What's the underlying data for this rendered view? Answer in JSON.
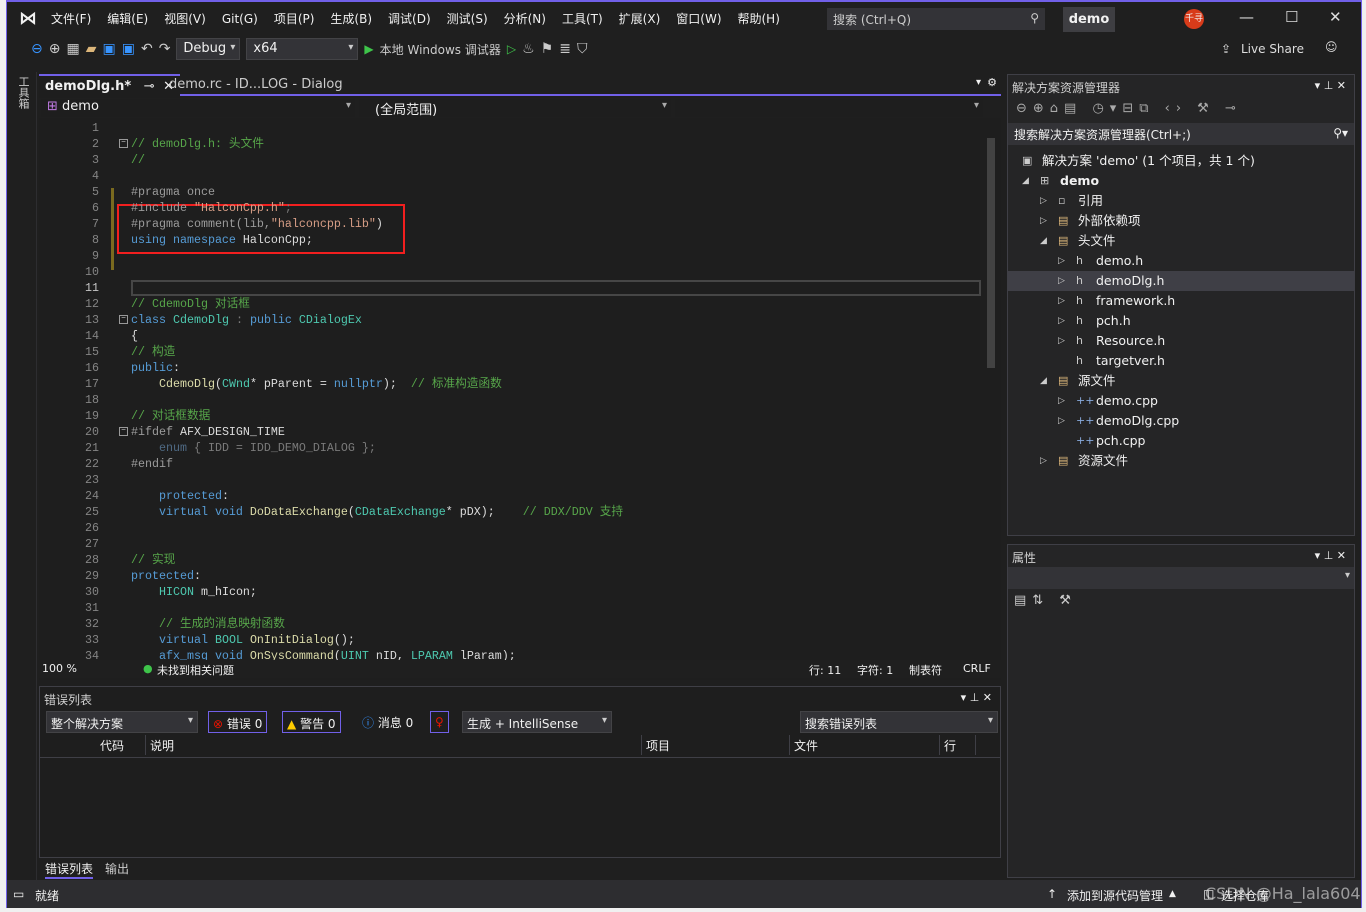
{
  "title": {
    "menu": [
      "文件(F)",
      "编辑(E)",
      "视图(V)",
      "Git(G)",
      "项目(P)",
      "生成(B)",
      "调试(D)",
      "测试(S)",
      "分析(N)",
      "工具(T)",
      "扩展(X)",
      "窗口(W)",
      "帮助(H)"
    ],
    "search": "搜索 (Ctrl+Q)",
    "solution_name": "demo",
    "avatar": "千寻",
    "minimize": "—",
    "maximize": "☐",
    "close": "✕"
  },
  "toolbar": {
    "config": "Debug",
    "platform": "x64",
    "run": "本地 Windows 调试器",
    "live_share": "Live Share"
  },
  "left_strip": {
    "toolbox": "工具箱"
  },
  "editor": {
    "tabs": [
      {
        "label": "demoDlg.h*",
        "active": true
      },
      {
        "label": "demo.rc - ID...LOG - Dialog"
      }
    ],
    "nav": {
      "project": "demo",
      "scope": "(全局范围)"
    },
    "current_line": 11,
    "lines": [
      [],
      [
        {
          "text": "// demoDlg.h: 头文件",
          "kind": "c"
        }
      ],
      [
        {
          "text": "//",
          "kind": "c"
        }
      ],
      [],
      [
        {
          "text": "#pragma once",
          "kind": "p"
        }
      ],
      [
        {
          "text": "#include ",
          "kind": "p"
        },
        {
          "text": "\"HalconCpp.h\"",
          "kind": "s"
        },
        {
          "text": ";",
          "kind": "dg"
        }
      ],
      [
        {
          "text": "#pragma comment(lib,",
          "kind": "p"
        },
        {
          "text": "\"halconcpp.lib\"",
          "kind": "s"
        },
        {
          "text": ")",
          "kind": ""
        }
      ],
      [
        {
          "text": "using namespace ",
          "kind": "k"
        },
        {
          "text": "HalconCpp;",
          "kind": ""
        }
      ],
      [],
      [],
      [],
      [
        {
          "text": "// CdemoDlg 对话框",
          "kind": "c"
        }
      ],
      [
        {
          "text": "class ",
          "kind": "k"
        },
        {
          "text": "CdemoDlg",
          "kind": "t"
        },
        {
          "text": " : ",
          "kind": "dg"
        },
        {
          "text": "public ",
          "kind": "k"
        },
        {
          "text": "CDialogEx",
          "kind": "t"
        }
      ],
      [
        {
          "text": "{",
          "kind": ""
        }
      ],
      [
        {
          "text": "// 构造",
          "kind": "c"
        }
      ],
      [
        {
          "text": "public",
          "kind": "k"
        },
        {
          "text": ":",
          "kind": ""
        }
      ],
      [
        {
          "text": "    CdemoDlg",
          "kind": "f"
        },
        {
          "text": "(",
          "kind": ""
        },
        {
          "text": "CWnd",
          "kind": "t"
        },
        {
          "text": "* pParent = ",
          "kind": ""
        },
        {
          "text": "nullptr",
          "kind": "k"
        },
        {
          "text": ");  ",
          "kind": ""
        },
        {
          "text": "// 标准构造函数",
          "kind": "c"
        }
      ],
      [],
      [
        {
          "text": "// 对话框数据",
          "kind": "c"
        }
      ],
      [
        {
          "text": "#ifdef ",
          "kind": "p"
        },
        {
          "text": "AFX_DESIGN_TIME",
          "kind": ""
        }
      ],
      [
        {
          "text": "    enum",
          "kind": "d"
        },
        {
          "text": " { IDD = IDD_DEMO_DIALOG };",
          "kind": "dg"
        }
      ],
      [
        {
          "text": "#endif",
          "kind": "p"
        }
      ],
      [],
      [
        {
          "text": "    protected",
          "kind": "k"
        },
        {
          "text": ":",
          "kind": ""
        }
      ],
      [
        {
          "text": "    virtual void ",
          "kind": "k"
        },
        {
          "text": "DoDataExchange",
          "kind": "f"
        },
        {
          "text": "(",
          "kind": ""
        },
        {
          "text": "CDataExchange",
          "kind": "t"
        },
        {
          "text": "* pDX);    ",
          "kind": ""
        },
        {
          "text": "// DDX/DDV 支持",
          "kind": "c"
        }
      ],
      [],
      [],
      [
        {
          "text": "// 实现",
          "kind": "c"
        }
      ],
      [
        {
          "text": "protected",
          "kind": "k"
        },
        {
          "text": ":",
          "kind": ""
        }
      ],
      [
        {
          "text": "    HICON",
          "kind": "t"
        },
        {
          "text": " m_hIcon;",
          "kind": ""
        }
      ],
      [],
      [
        {
          "text": "    // 生成的消息映射函数",
          "kind": "c"
        }
      ],
      [
        {
          "text": "    virtual ",
          "kind": "k"
        },
        {
          "text": "BOOL ",
          "kind": "t"
        },
        {
          "text": "OnInitDialog",
          "kind": "f"
        },
        {
          "text": "();",
          "kind": ""
        }
      ],
      [
        {
          "text": "    afx_msg void ",
          "kind": "k"
        },
        {
          "text": "OnSysCommand",
          "kind": "f"
        },
        {
          "text": "(",
          "kind": ""
        },
        {
          "text": "UINT",
          "kind": "t"
        },
        {
          "text": " nID, ",
          "kind": ""
        },
        {
          "text": "LPARAM",
          "kind": "t"
        },
        {
          "text": " lParam);",
          "kind": ""
        }
      ]
    ],
    "status": {
      "zoom": "100 %",
      "issues": "未找到相关问题",
      "line": "行: 11",
      "col": "字符: 1",
      "tabs": "制表符",
      "eol": "CRLF"
    }
  },
  "error_list": {
    "title": "错误列表",
    "scope": "整个解决方案",
    "errors": "错误 0",
    "warnings": "警告 0",
    "messages": "消息 0",
    "source": "生成 + IntelliSense",
    "search": "搜索错误列表",
    "columns": [
      "代码",
      "说明",
      "项目",
      "文件",
      "行"
    ],
    "tabs": [
      "错误列表",
      "输出"
    ]
  },
  "solution_explorer": {
    "title": "解决方案资源管理器",
    "search": "搜索解决方案资源管理器(Ctrl+;)",
    "items": [
      {
        "label": "解决方案 'demo' (1 个项目，共 1 个)",
        "level": 0,
        "arrow": "",
        "icon": "▣"
      },
      {
        "label": "demo",
        "level": 1,
        "arrow": "◢",
        "icon": "⊞",
        "bold": true
      },
      {
        "label": "引用",
        "level": 2,
        "arrow": "▷",
        "icon": "▫"
      },
      {
        "label": "外部依赖项",
        "level": 2,
        "arrow": "▷",
        "icon": "▤"
      },
      {
        "label": "头文件",
        "level": 2,
        "arrow": "◢",
        "icon": "▤"
      },
      {
        "label": "demo.h",
        "level": 3,
        "arrow": "▷",
        "icon": "h"
      },
      {
        "label": "demoDlg.h",
        "level": 3,
        "arrow": "▷",
        "icon": "h",
        "selected": true
      },
      {
        "label": "framework.h",
        "level": 3,
        "arrow": "▷",
        "icon": "h"
      },
      {
        "label": "pch.h",
        "level": 3,
        "arrow": "▷",
        "icon": "h"
      },
      {
        "label": "Resource.h",
        "level": 3,
        "arrow": "▷",
        "icon": "h"
      },
      {
        "label": "targetver.h",
        "level": 3,
        "arrow": "",
        "icon": "h"
      },
      {
        "label": "源文件",
        "level": 2,
        "arrow": "◢",
        "icon": "▤"
      },
      {
        "label": "demo.cpp",
        "level": 3,
        "arrow": "▷",
        "icon": "++"
      },
      {
        "label": "demoDlg.cpp",
        "level": 3,
        "arrow": "▷",
        "icon": "++"
      },
      {
        "label": "pch.cpp",
        "level": 3,
        "arrow": "",
        "icon": "++"
      },
      {
        "label": "资源文件",
        "level": 2,
        "arrow": "▷",
        "icon": "▤"
      }
    ]
  },
  "properties": {
    "title": "属性"
  },
  "statusbar": {
    "ready": "就绪",
    "source_control": "添加到源代码管理",
    "repo": "选择仓库",
    "watermark": "CSDN @Ha_lala604"
  },
  "colors": {
    "accent": "#7160e8",
    "highlight_box": "#f21f1f",
    "comment": "#57a64a",
    "keyword": "#569cd6",
    "type": "#4ec9b0",
    "string": "#d69d85"
  }
}
